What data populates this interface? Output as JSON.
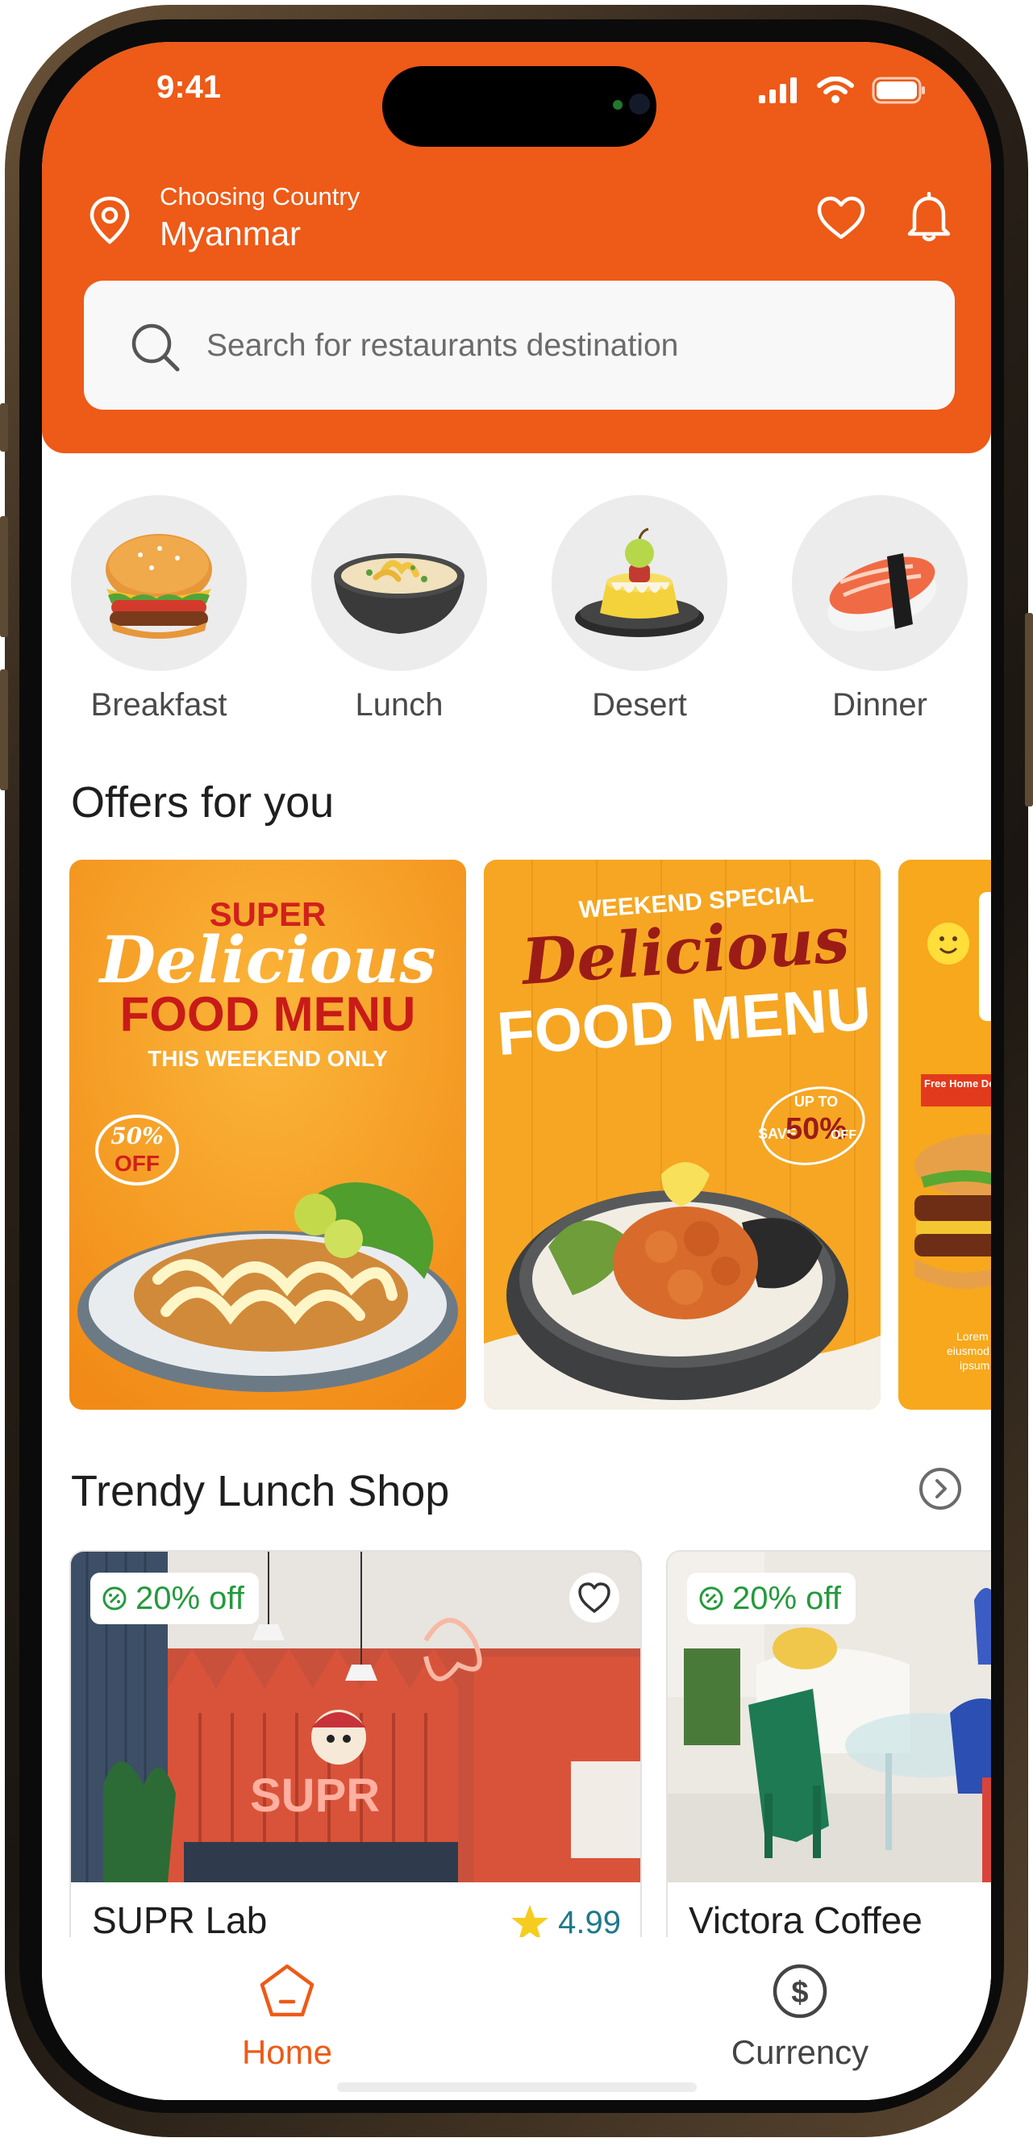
{
  "status_bar": {
    "time": "9:41"
  },
  "header": {
    "location_label": "Choosing Country",
    "location_value": "Myanmar",
    "accent": "#ee5a17"
  },
  "search": {
    "placeholder": "Search for restaurants destination"
  },
  "categories": [
    {
      "label": "Breakfast",
      "icon": "burger-icon"
    },
    {
      "label": "Lunch",
      "icon": "soup-bowl-icon"
    },
    {
      "label": "Desert",
      "icon": "pudding-icon"
    },
    {
      "label": "Dinner",
      "icon": "sushi-icon"
    }
  ],
  "offers": {
    "title": "Offers for you",
    "cards": [
      {
        "line1": "SUPER",
        "line2": "Delicious",
        "line3": "FOOD MENU",
        "line4": "THIS WEEKEND ONLY",
        "discount_pct": "50%",
        "discount_off": "OFF"
      },
      {
        "line1": "WEEKEND SPECIAL",
        "line2": "Delicious",
        "line3": "FOOD MENU",
        "save_upto": "UP TO",
        "save_label": "SAVE",
        "save_pct": "50%",
        "save_off": "OFF"
      },
      {
        "ribbon": "Free Home Delivery",
        "lorem1": "Lorem ip",
        "lorem2": "eiusmod te",
        "lorem3": "ipsum s"
      }
    ]
  },
  "trendy": {
    "title": "Trendy Lunch Shop",
    "shops": [
      {
        "badge": "20% off",
        "name": "SUPR Lab",
        "rating": "4.99",
        "sign_text": "SUPR"
      },
      {
        "badge": "20% off",
        "name": "Victora Coffee"
      }
    ]
  },
  "tabbar": {
    "home": "Home",
    "currency": "Currency",
    "active_color": "#ee5a17"
  }
}
